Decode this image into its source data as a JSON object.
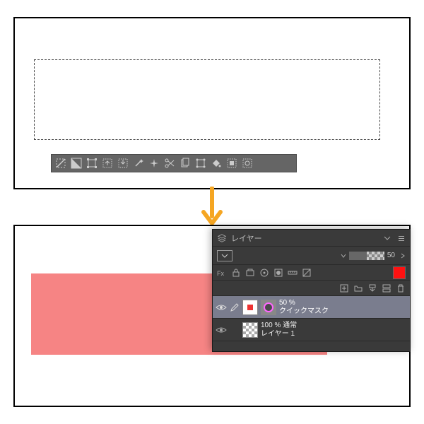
{
  "arrow_color": "#f5a623",
  "layers_panel": {
    "title": "レイヤー",
    "opacity_value": "50",
    "opacity_suffix": "",
    "layer1": {
      "opacity_mode": "50 %",
      "name": "クイックマスク"
    },
    "layer2": {
      "opacity_mode": "100 % 通常",
      "name": "レイヤー 1"
    }
  },
  "toolbar": {
    "tools": [
      "deselect",
      "invert",
      "crop",
      "expand",
      "shrink",
      "magic",
      "sparkle",
      "scissors",
      "crop2",
      "move",
      "paint",
      "mask",
      "cancel"
    ]
  }
}
